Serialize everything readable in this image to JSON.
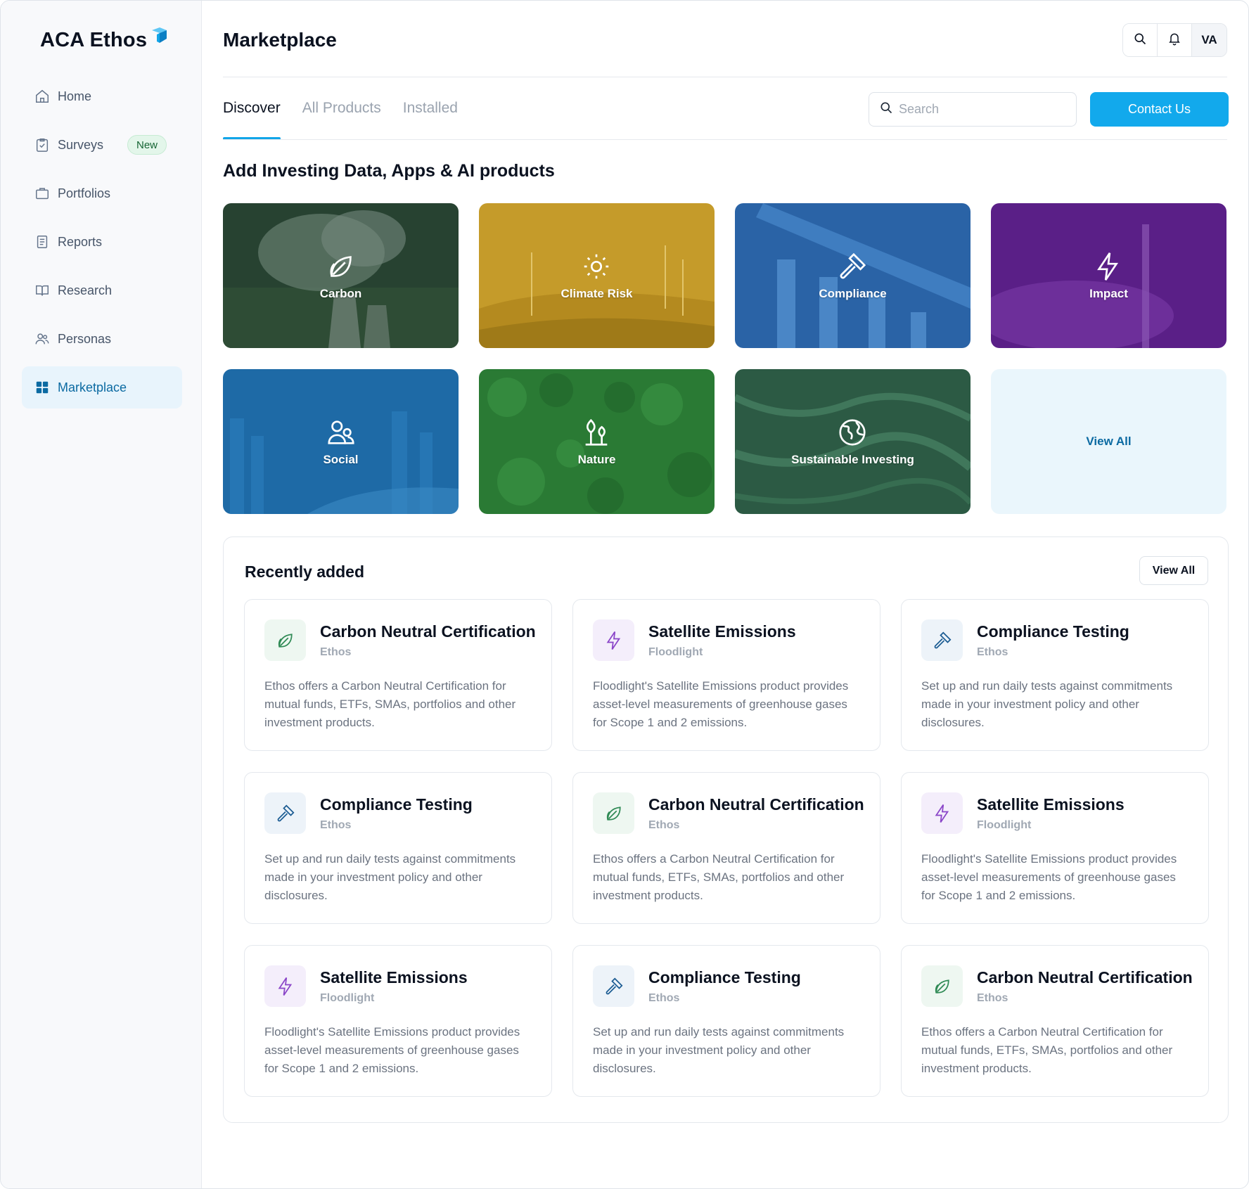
{
  "app": {
    "logo_text": "ACA Ethos",
    "logo_mark_color": "#12a5e8"
  },
  "sidebar": {
    "items": [
      {
        "label": "Home",
        "icon": "home-icon"
      },
      {
        "label": "Surveys",
        "icon": "clipboard-icon",
        "badge": "New"
      },
      {
        "label": "Portfolios",
        "icon": "briefcase-icon"
      },
      {
        "label": "Reports",
        "icon": "document-icon"
      },
      {
        "label": "Research",
        "icon": "book-icon"
      },
      {
        "label": "Personas",
        "icon": "users-icon"
      },
      {
        "label": "Marketplace",
        "icon": "grid-icon",
        "active": true
      }
    ]
  },
  "header": {
    "title": "Marketplace",
    "avatar_initials": "VA"
  },
  "tabs": [
    {
      "label": "Discover",
      "active": true
    },
    {
      "label": "All Products"
    },
    {
      "label": "Installed"
    }
  ],
  "search": {
    "placeholder": "Search",
    "value": ""
  },
  "contact_button": "Contact Us",
  "colors": {
    "accent": "#12a9ec",
    "active_nav_bg": "#e8f4fc",
    "badge_green": "#166534"
  },
  "categories_title": "Add Investing Data, Apps & AI products",
  "categories": [
    {
      "label": "Carbon",
      "icon": "leaf-icon",
      "color": "#2d4a3a"
    },
    {
      "label": "Climate Risk",
      "icon": "sun-icon",
      "color": "#c79b2c"
    },
    {
      "label": "Compliance",
      "icon": "gavel-icon",
      "color": "#2b64a8"
    },
    {
      "label": "Impact",
      "icon": "lightning-icon",
      "color": "#5b1f86"
    },
    {
      "label": "Social",
      "icon": "users-icon",
      "color": "#1e6aa6"
    },
    {
      "label": "Nature",
      "icon": "plant-icon",
      "color": "#2a7a34"
    },
    {
      "label": "Sustainable Investing",
      "icon": "globe-icon",
      "color": "#2d5c45"
    },
    {
      "label": "View All"
    }
  ],
  "recent": {
    "title": "Recently added",
    "view_all": "View All",
    "cards": [
      {
        "title": "Carbon Neutral Certification",
        "vendor": "Ethos",
        "icon": "leaf-icon",
        "desc": "Ethos offers a Carbon Neutral Certification for mutual funds, ETFs, SMAs, portfolios and other investment products."
      },
      {
        "title": "Satellite Emissions",
        "vendor": "Floodlight",
        "icon": "lightning-icon",
        "desc": "Floodlight's Satellite Emissions product provides asset-level measurements of greenhouse gases for Scope 1 and 2 emissions."
      },
      {
        "title": "Compliance Testing",
        "vendor": "Ethos",
        "icon": "gavel-icon",
        "desc": "Set up and run daily tests against commitments made in your investment policy and other disclosures."
      },
      {
        "title": "Compliance Testing",
        "vendor": "Ethos",
        "icon": "gavel-icon",
        "desc": "Set up and run daily tests against commitments made in your investment policy and other disclosures."
      },
      {
        "title": "Carbon Neutral Certification",
        "vendor": "Ethos",
        "icon": "leaf-icon",
        "desc": "Ethos offers a Carbon Neutral Certification for mutual funds, ETFs, SMAs, portfolios and other investment products."
      },
      {
        "title": "Satellite Emissions",
        "vendor": "Floodlight",
        "icon": "lightning-icon",
        "desc": "Floodlight's Satellite Emissions product provides asset-level measurements of greenhouse gases for Scope 1 and 2 emissions."
      },
      {
        "title": "Satellite Emissions",
        "vendor": "Floodlight",
        "icon": "lightning-icon",
        "desc": "Floodlight's Satellite Emissions product provides asset-level measurements of greenhouse gases for Scope 1 and 2 emissions."
      },
      {
        "title": "Compliance Testing",
        "vendor": "Ethos",
        "icon": "gavel-icon",
        "desc": "Set up and run daily tests against commitments made in your investment policy and other disclosures."
      },
      {
        "title": "Carbon Neutral Certification",
        "vendor": "Ethos",
        "icon": "leaf-icon",
        "desc": "Ethos offers a Carbon Neutral Certification for mutual funds, ETFs, SMAs, portfolios and other investment products."
      }
    ]
  }
}
